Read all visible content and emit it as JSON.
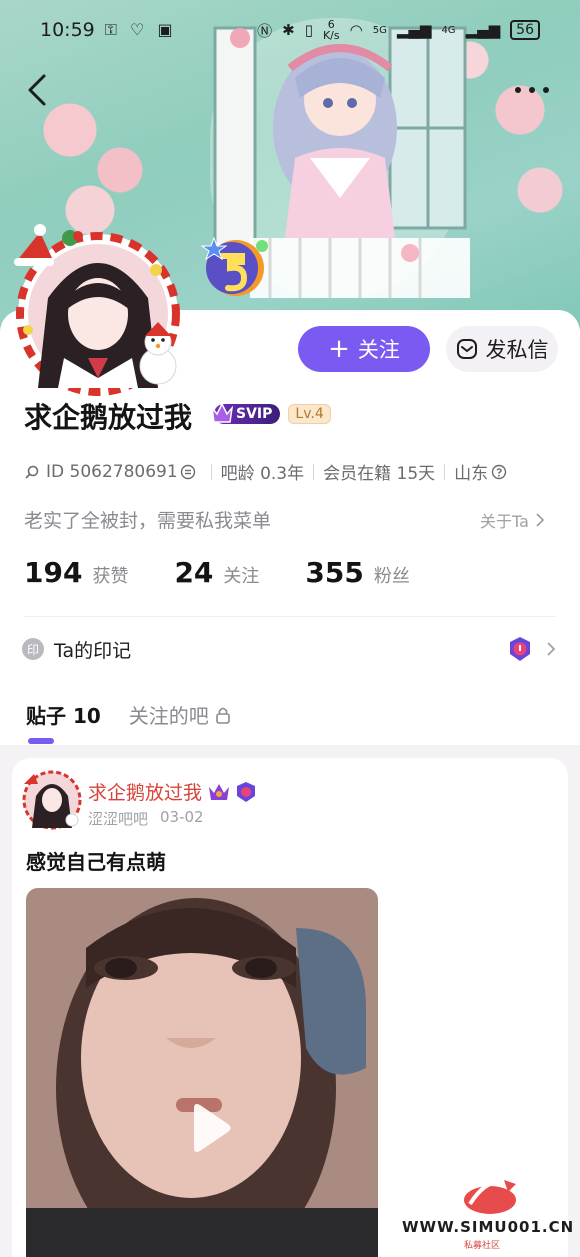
{
  "status_bar": {
    "time": "10:59",
    "left_icons": "⚿ ♡ ▣",
    "net_speed_value": "6",
    "net_speed_unit": "K/s",
    "signal_a": "5G",
    "signal_b": "4G",
    "battery": "56"
  },
  "profile": {
    "name": "求企鹅放过我",
    "svip_label": "SVIP",
    "level_label": "Lv.4",
    "id_text": "ID 5062780691",
    "bar_age": "吧龄 0.3年",
    "membership": "会员在籍 15天",
    "location": "山东",
    "bio": "老实了全被封，需要私我菜单",
    "about_label": "关于Ta"
  },
  "actions": {
    "follow_label": "关注",
    "follow_glyph": "+",
    "message_label": "发私信"
  },
  "stats": [
    {
      "value": "194",
      "label": "获赞"
    },
    {
      "value": "24",
      "label": "关注"
    },
    {
      "value": "355",
      "label": "粉丝"
    }
  ],
  "mark": {
    "icon_text": "印",
    "label": "Ta的印记"
  },
  "tabs": [
    {
      "label": "贴子 10",
      "active": true
    },
    {
      "label": "关注的吧",
      "active": false
    }
  ],
  "post": {
    "author": "求企鹅放过我",
    "forum": "涩涩吧吧",
    "date": "03-02",
    "title": "感觉自己有点萌"
  },
  "watermark": {
    "url": "WWW.SIMU001.CN",
    "sub": "私募社区"
  },
  "colors": {
    "accent": "#7a5af0",
    "author_red": "#d8443b",
    "banner_teal": "#8fcdbd"
  },
  "icons": [
    "back-icon",
    "more-icon",
    "mail-icon",
    "search-icon",
    "copy-icon",
    "help-icon",
    "chevron-right-icon",
    "lock-icon",
    "play-icon",
    "crown-icon"
  ]
}
